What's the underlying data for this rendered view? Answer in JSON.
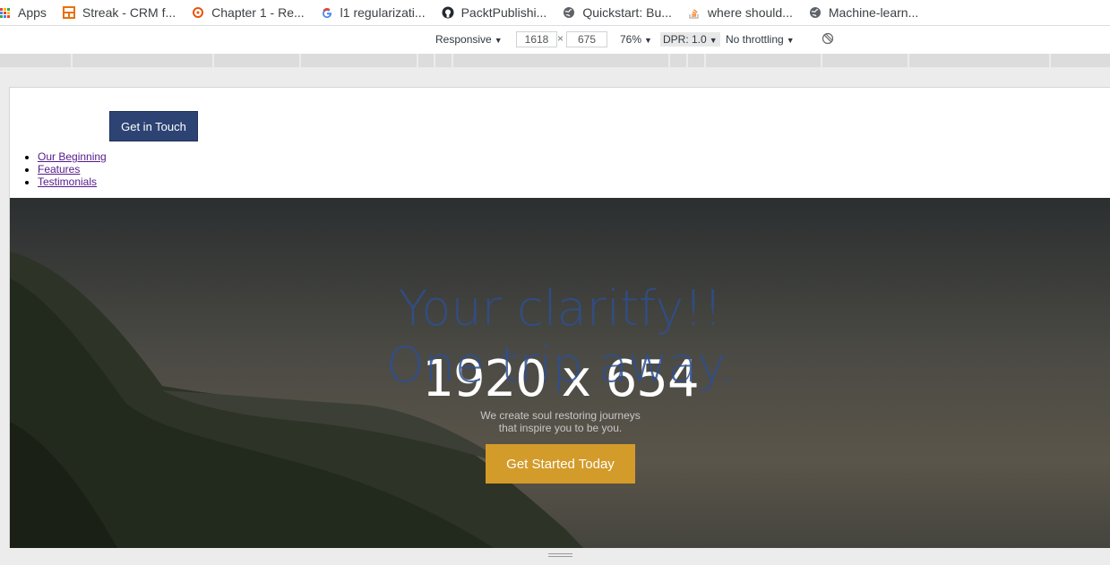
{
  "bookmarks": [
    {
      "icon": "apps-icon",
      "label": "Apps"
    },
    {
      "icon": "streak-icon",
      "label": "Streak - CRM f..."
    },
    {
      "icon": "chapter-icon",
      "label": "Chapter 1 - Re..."
    },
    {
      "icon": "google-icon",
      "label": "l1 regularizati..."
    },
    {
      "icon": "github-icon",
      "label": "PacktPublishi..."
    },
    {
      "icon": "globe-icon",
      "label": "Quickstart: Bu..."
    },
    {
      "icon": "stackoverflow-icon",
      "label": "where should..."
    },
    {
      "icon": "globe-icon",
      "label": "Machine-learn..."
    }
  ],
  "devtools": {
    "device": "Responsive",
    "width": "1618",
    "separator": "×",
    "height": "675",
    "zoom": "76%",
    "dpr": "DPR: 1.0",
    "throttling": "No throttling"
  },
  "page": {
    "cta_top": "Get in Touch",
    "nav": [
      "Our Beginning",
      "Features",
      "Testimonials"
    ],
    "hero": {
      "title_line1": "Your claritfy!!",
      "title_line2": "One trip away.",
      "placeholder_size": "1920 x 654",
      "subtitle_line1": "We create soul restoring journeys",
      "subtitle_line2": "that inspire you to be you.",
      "button": "Get Started Today"
    }
  },
  "colors": {
    "cta_top_bg": "#2d4373",
    "hero_button_bg": "#d39b2a",
    "hero_title": "#2f4f8f",
    "link": "#551a8b"
  }
}
